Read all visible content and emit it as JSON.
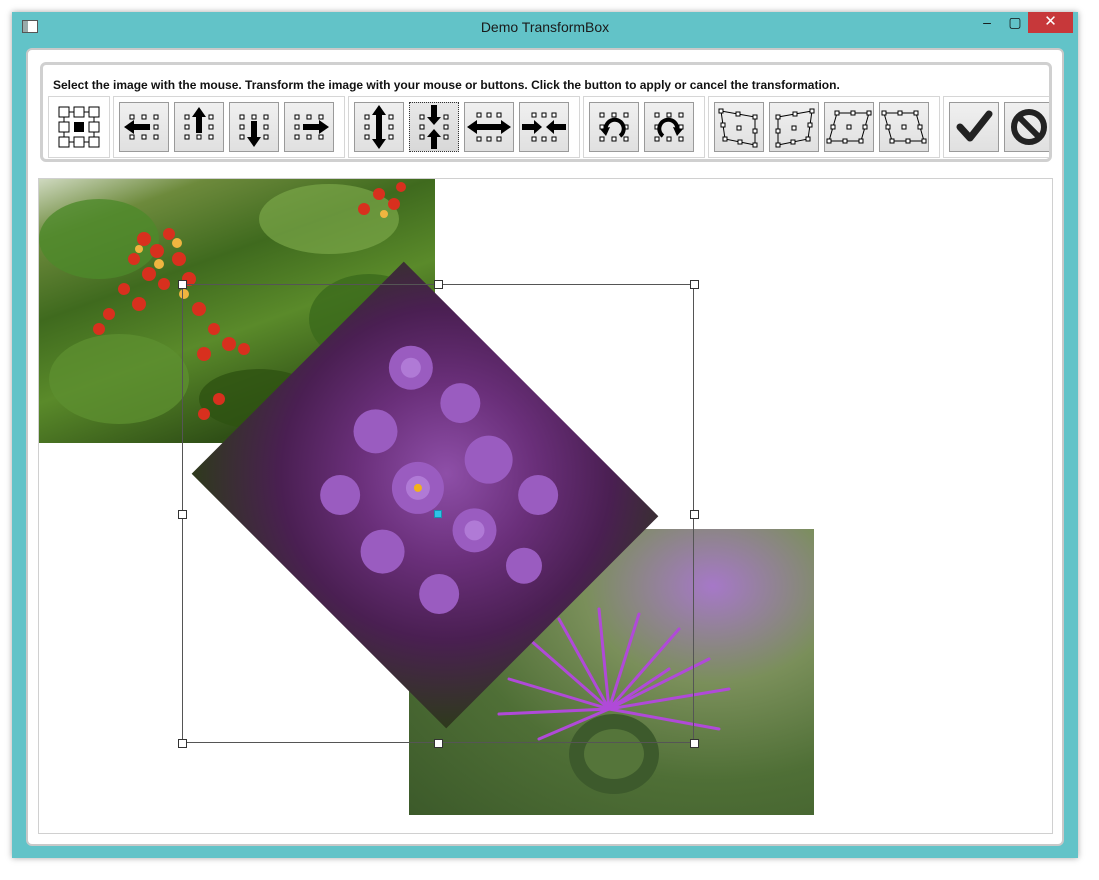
{
  "window": {
    "title": "Demo TransformBox",
    "minimize_glyph": "–",
    "maximize_glyph": "▢",
    "close_glyph": "✕"
  },
  "toolbar": {
    "instruction": "Select the image with the mouse. Transform the image with your mouse or buttons. Click the button to apply or cancel the transformation."
  },
  "icons": [
    "select-box-icon",
    "move-left-icon",
    "move-up-icon",
    "move-down-icon",
    "move-right-icon",
    "stretch-vertical-icon",
    "shrink-vertical-icon",
    "stretch-horizontal-icon",
    "shrink-horizontal-icon",
    "rotate-left-icon",
    "rotate-right-icon",
    "skew-left-icon",
    "skew-right-icon",
    "skew-top-icon",
    "skew-bottom-icon",
    "apply-checkmark-icon",
    "cancel-icon"
  ],
  "colors": {
    "window_frame": "#62c3c8",
    "close_button": "#c7383a"
  }
}
